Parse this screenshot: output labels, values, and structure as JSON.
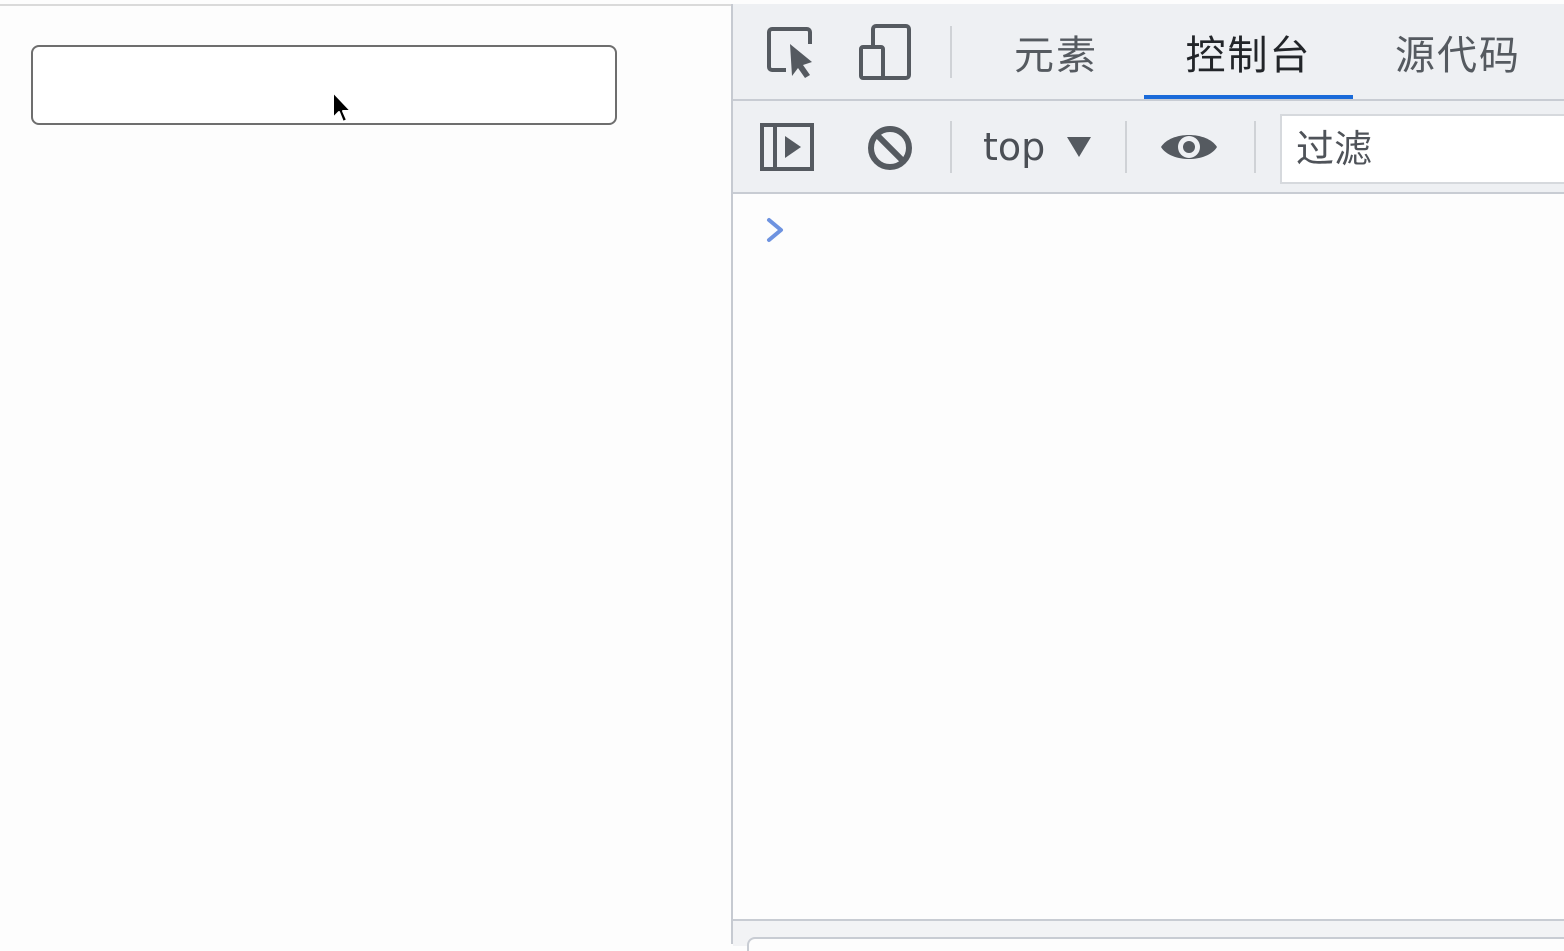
{
  "page": {
    "text_input_value": ""
  },
  "devtools": {
    "tabs": [
      {
        "label": "元素",
        "active": false
      },
      {
        "label": "控制台",
        "active": true
      },
      {
        "label": "源代码",
        "active": false
      }
    ],
    "toolbar": {
      "context_label": "top",
      "filter_placeholder": "过滤"
    },
    "icons": {
      "inspect": "inspect-element-icon",
      "device": "device-toolbar-icon",
      "sidebar": "show-sidebar-icon",
      "clear": "clear-console-icon",
      "live_expression": "eye-icon",
      "prompt": "chevron-right-icon"
    },
    "colors": {
      "accent": "#1a6ad9",
      "prompt": "#6e93e0"
    }
  }
}
